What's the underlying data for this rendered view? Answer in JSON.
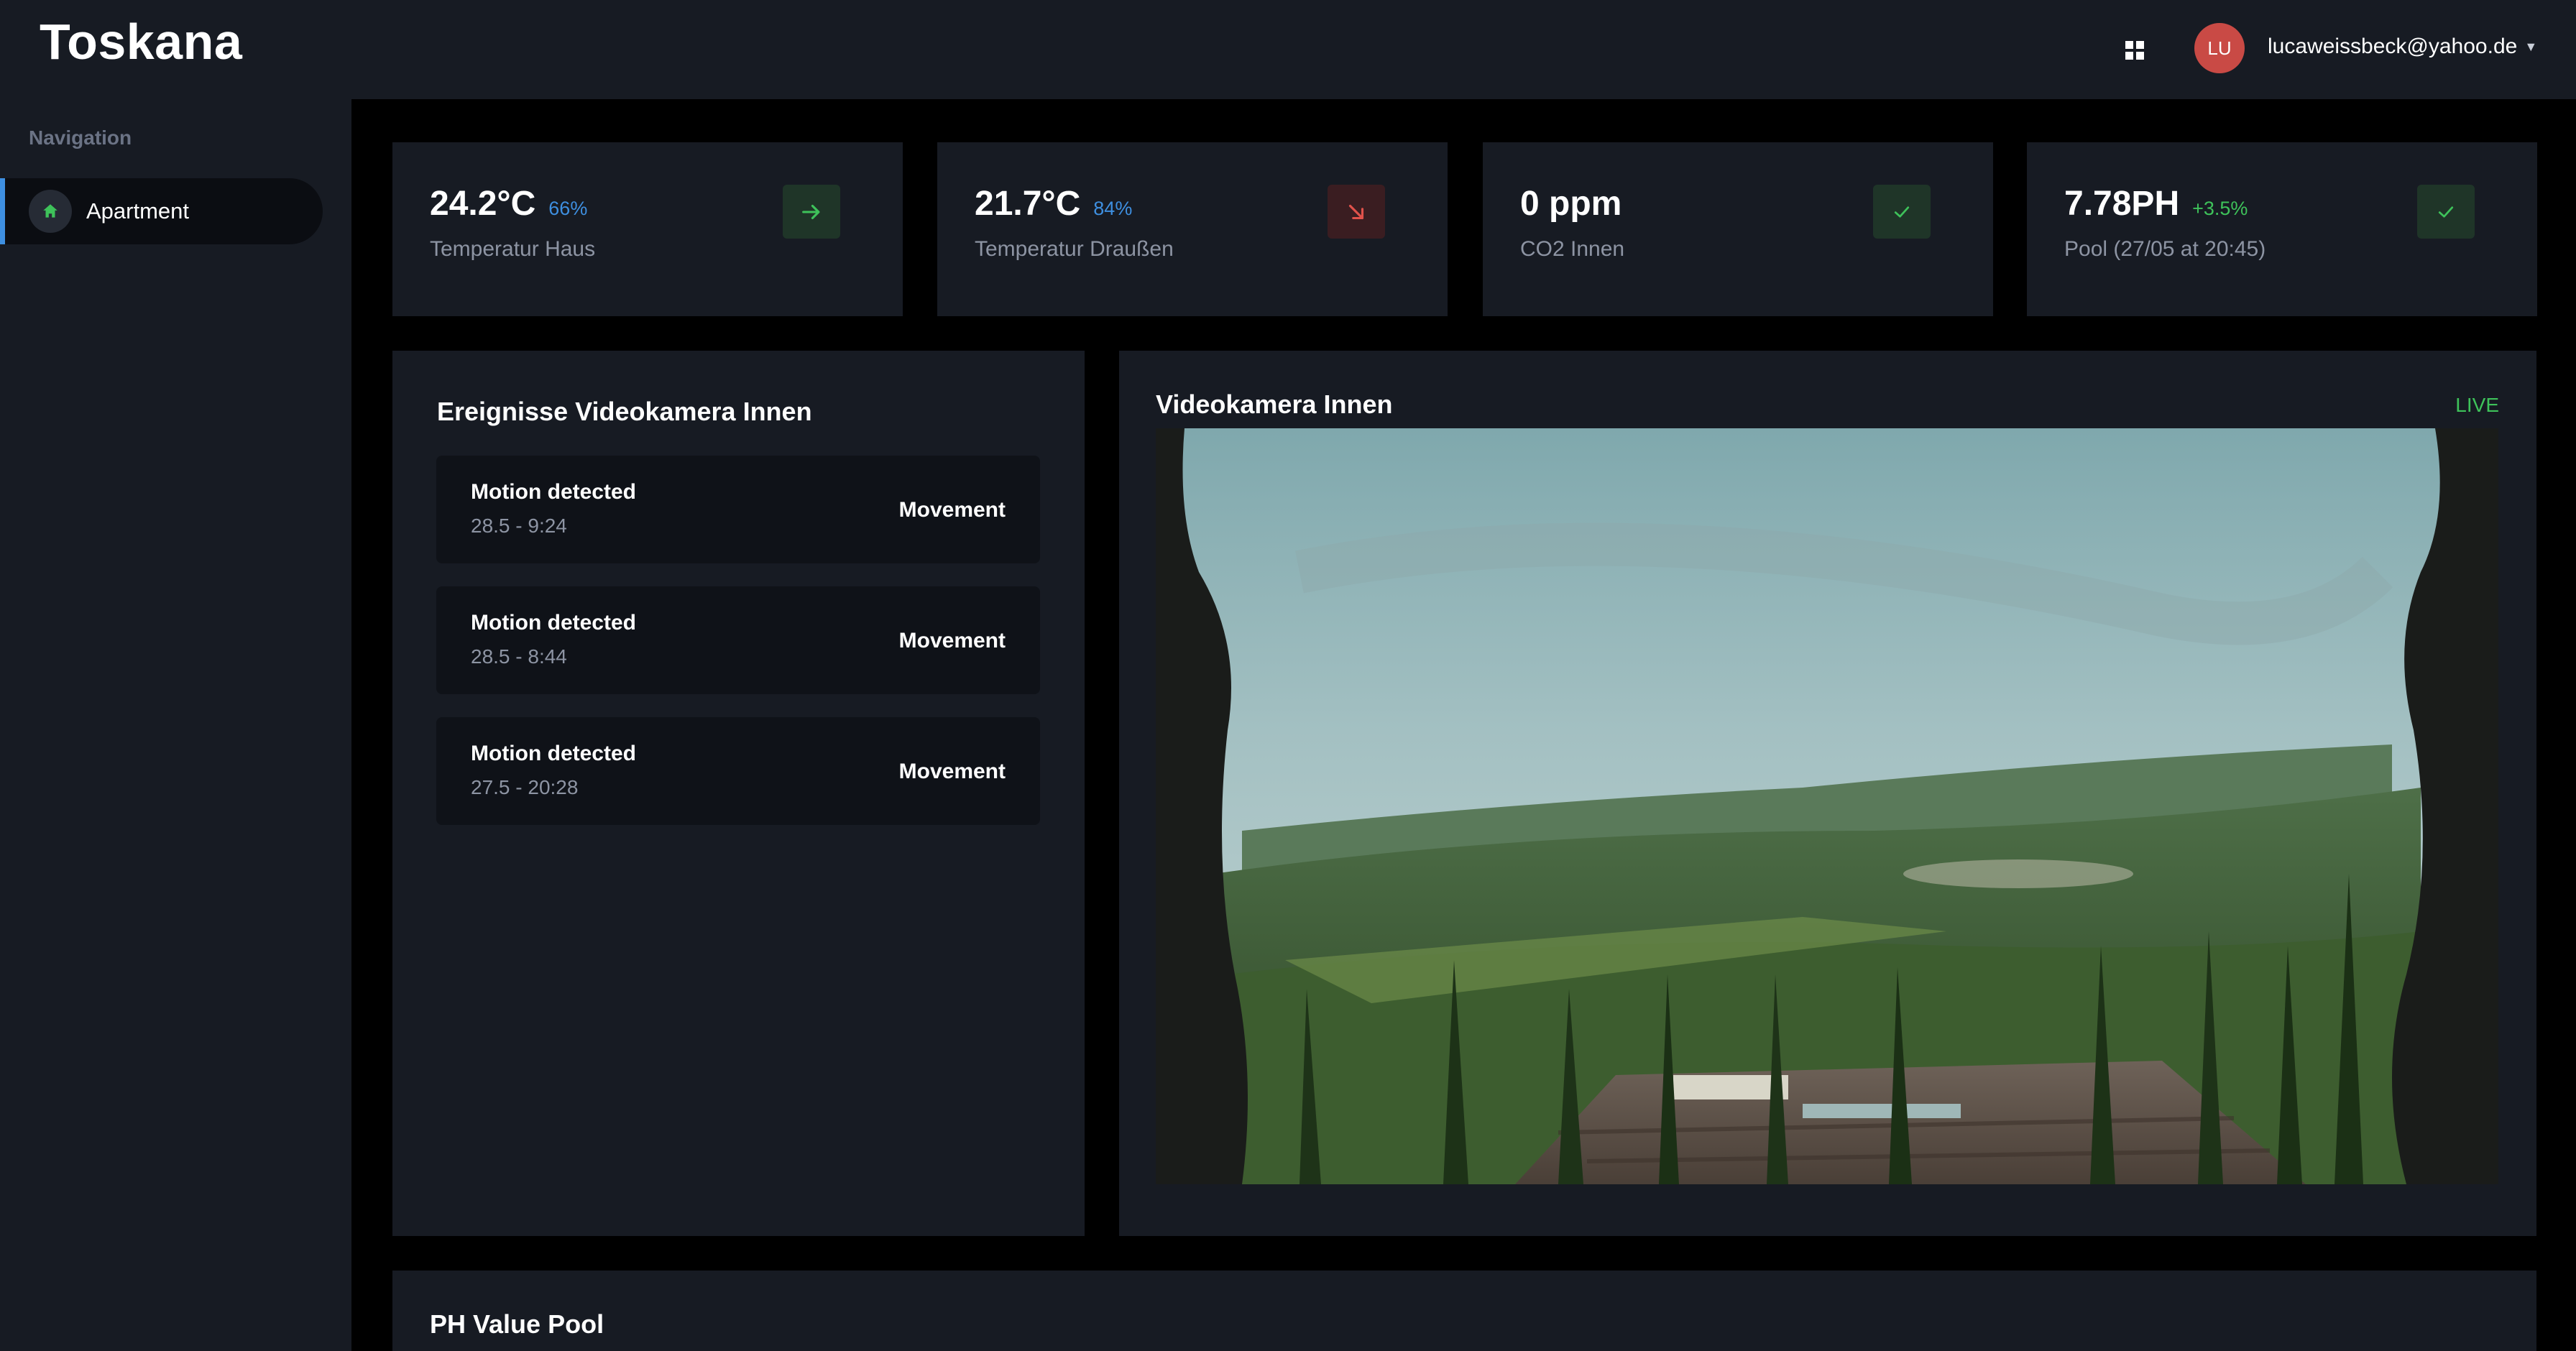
{
  "app": {
    "title": "Toskana"
  },
  "header": {
    "apps_icon": "grid-icon",
    "avatar_initials": "LU",
    "user_email": "lucaweissbeck@yahoo.de"
  },
  "sidebar": {
    "heading": "Navigation",
    "items": [
      {
        "label": "Apartment",
        "icon": "home-icon"
      }
    ]
  },
  "kpis": [
    {
      "value": "24.2°C",
      "sub": "66%",
      "sub_color": "#3e8fe0",
      "label": "Temperatur Haus",
      "badge_icon": "arrow-right-icon",
      "status": "ok"
    },
    {
      "value": "21.7°C",
      "sub": "84%",
      "sub_color": "#3e8fe0",
      "label": "Temperatur Draußen",
      "badge_icon": "arrow-down-right-icon",
      "status": "warning"
    },
    {
      "value": "0 ppm",
      "sub": "",
      "label": "CO2 Innen",
      "badge_icon": "check-icon",
      "status": "ok"
    },
    {
      "value": "7.78PH",
      "sub": "+3.5%",
      "sub_color": "#3ec25a",
      "label": "Pool (27/05 at 20:45)",
      "badge_icon": "check-icon",
      "status": "ok"
    }
  ],
  "events": {
    "title": "Ereignisse Videokamera Innen",
    "items": [
      {
        "title": "Motion detected",
        "time": "28.5 - 9:24",
        "type": "Movement"
      },
      {
        "title": "Motion detected",
        "time": "28.5 - 8:44",
        "type": "Movement"
      },
      {
        "title": "Motion detected",
        "time": "27.5 - 20:28",
        "type": "Movement"
      }
    ]
  },
  "camera": {
    "title": "Videokamera Innen",
    "status": "LIVE"
  },
  "ph_panel": {
    "title": "PH Value Pool"
  },
  "colors": {
    "accent_blue": "#3e8fe0",
    "accent_green": "#3ec25a",
    "accent_red": "#e0524b",
    "card_bg": "#171b23",
    "page_bg": "#000000"
  }
}
